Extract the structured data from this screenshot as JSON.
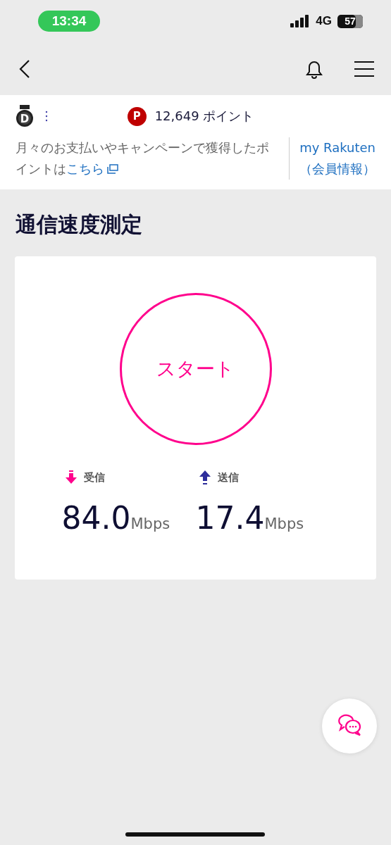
{
  "status_bar": {
    "time": "13:34",
    "network": "4G",
    "battery": "57"
  },
  "points": {
    "rank_letter": "D",
    "badge": "P",
    "amount": "12,649 ポイント",
    "note": "月々のお支払いやキャンペーンで獲得したポイントは",
    "note_link": "こちら",
    "member_link_1": "my Rakuten",
    "member_link_2": "（会員情報）"
  },
  "title": "通信速度測定",
  "start_button": "スタート",
  "results": [
    {
      "kind": "download",
      "label": "受信",
      "value": "84.0",
      "unit": "Mbps"
    },
    {
      "kind": "upload",
      "label": "送信",
      "value": "17.4",
      "unit": "Mbps"
    }
  ]
}
